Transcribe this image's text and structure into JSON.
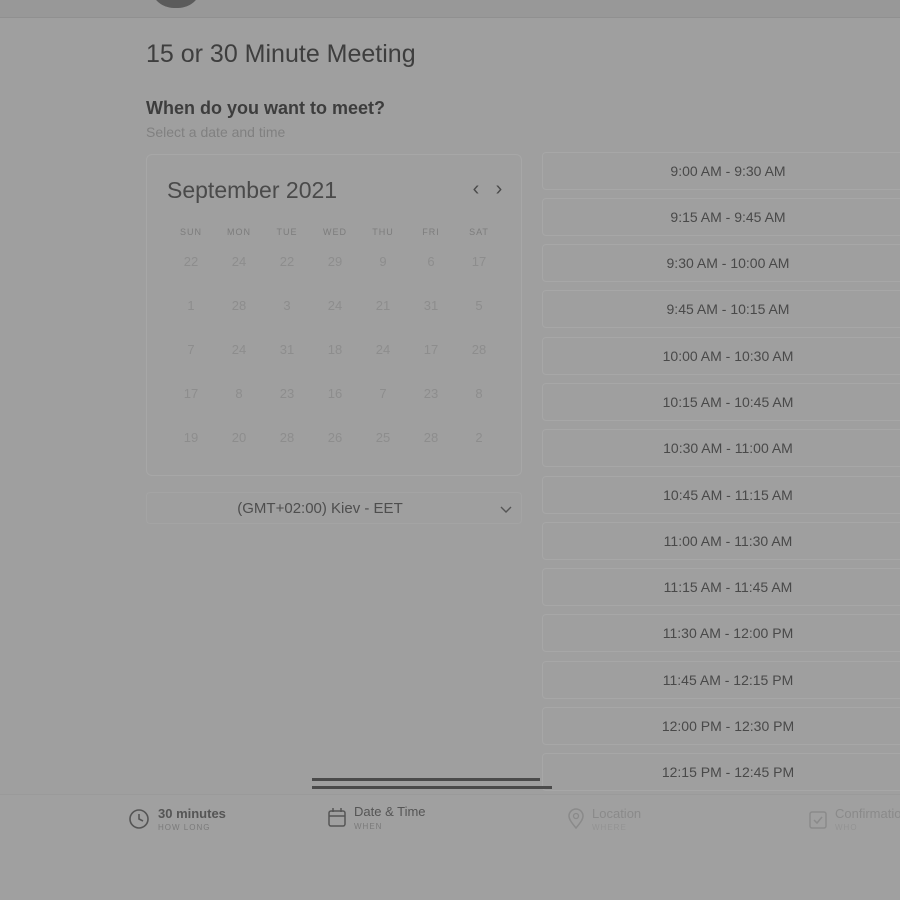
{
  "header": {
    "text": ""
  },
  "meeting": {
    "title": "15 or 30 Minute Meeting",
    "question": "When do you want to meet?",
    "instruction": "Select a date and time"
  },
  "calendar": {
    "month_label": "September 2021",
    "weekdays": [
      "SUN",
      "MON",
      "TUE",
      "WED",
      "THU",
      "FRI",
      "SAT"
    ],
    "weeks": [
      [
        "22",
        "24",
        "22",
        "29",
        "9",
        "6",
        "17"
      ],
      [
        "1",
        "28",
        "3",
        "24",
        "21",
        "31",
        "5"
      ],
      [
        "7",
        "24",
        "31",
        "18",
        "24",
        "17",
        "28"
      ],
      [
        "17",
        "8",
        "23",
        "16",
        "7",
        "23",
        "8"
      ],
      [
        "19",
        "20",
        "28",
        "26",
        "25",
        "28",
        "2"
      ]
    ]
  },
  "timezone": {
    "label": "(GMT+02:00) Kiev - EET"
  },
  "time_slots": [
    "9:00 AM - 9:30 AM",
    "9:15 AM - 9:45 AM",
    "9:30 AM - 10:00 AM",
    "9:45 AM - 10:15 AM",
    "10:00 AM - 10:30 AM",
    "10:15 AM - 10:45 AM",
    "10:30 AM - 11:00 AM",
    "10:45 AM - 11:15 AM",
    "11:00 AM - 11:30 AM",
    "11:15 AM - 11:45 AM",
    "11:30 AM - 12:00 PM",
    "11:45 AM - 12:15 PM",
    "12:00 PM - 12:30 PM",
    "12:15 PM - 12:45 PM"
  ],
  "steps": [
    {
      "label": "30 minutes",
      "sub": "HOW LONG",
      "icon": "clock-icon"
    },
    {
      "label": "Date & Time",
      "sub": "WHEN",
      "icon": "calendar-icon"
    },
    {
      "label": "Location",
      "sub": "WHERE",
      "icon": "location-pin-icon"
    },
    {
      "label": "Confirmation",
      "sub": "WHO",
      "icon": "confirm-icon"
    }
  ]
}
